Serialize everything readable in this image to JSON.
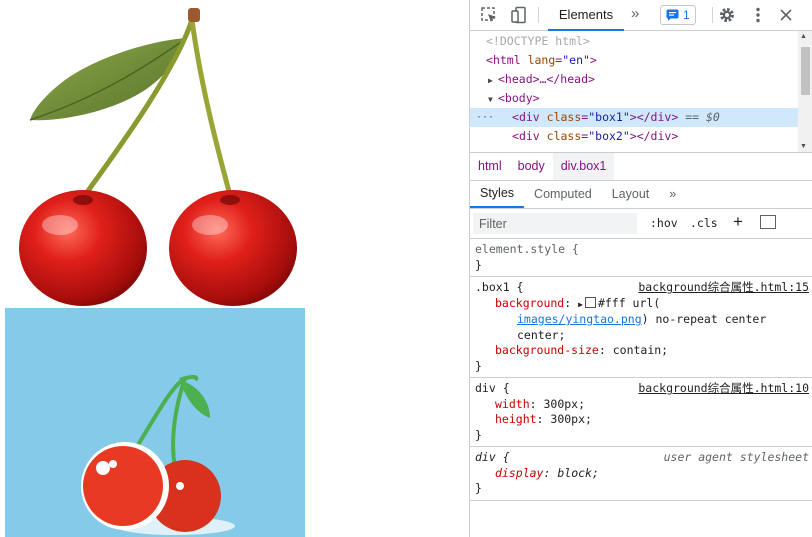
{
  "devtools": {
    "tabs": {
      "active": "Elements",
      "more": "»"
    },
    "issues_count": "1",
    "dom": {
      "doctype": "<!DOCTYPE html>",
      "html_tag": "html",
      "html_attr": "lang",
      "html_val": "\"en\"",
      "head": "<head>…</head>",
      "body_open": "<body>",
      "box1_tag": "div",
      "class_attr": "class",
      "box1_val": "\"box1\"",
      "selected_marker": "== $0",
      "box2_val": "\"box2\"",
      "dots": "···"
    },
    "breadcrumbs": [
      "html",
      "body",
      "div.box1"
    ],
    "subtabs": [
      "Styles",
      "Computed",
      "Layout",
      "»"
    ],
    "filter_placeholder": "Filter",
    "filter_hov": ":hov",
    "filter_cls": ".cls",
    "filter_plus": "+",
    "rules": {
      "element_style": {
        "selector": "element.style {",
        "close": "}"
      },
      "box1": {
        "selector": ".box1 {",
        "source": "background综合属性.html:15",
        "bg_prop": "background",
        "bg_val_1": "#fff url(",
        "bg_link": "images/yingtao.png",
        "bg_val_2": ") no-repeat center",
        "bg_val_3": "center;",
        "bgs_prop": "background-size",
        "bgs_val": "contain;",
        "close": "}"
      },
      "div": {
        "selector": "div {",
        "source": "background综合属性.html:10",
        "w_prop": "width",
        "w_val": "300px;",
        "h_prop": "height",
        "h_val": "300px;",
        "close": "}"
      },
      "ua": {
        "selector": "div {",
        "source": "user agent stylesheet",
        "d_prop": "display",
        "d_val": "block;",
        "close": "}"
      }
    }
  },
  "colors": {
    "box2_bg": "#86cae9",
    "accent": "#1a73e8",
    "selected_row": "#cfe8fc"
  }
}
